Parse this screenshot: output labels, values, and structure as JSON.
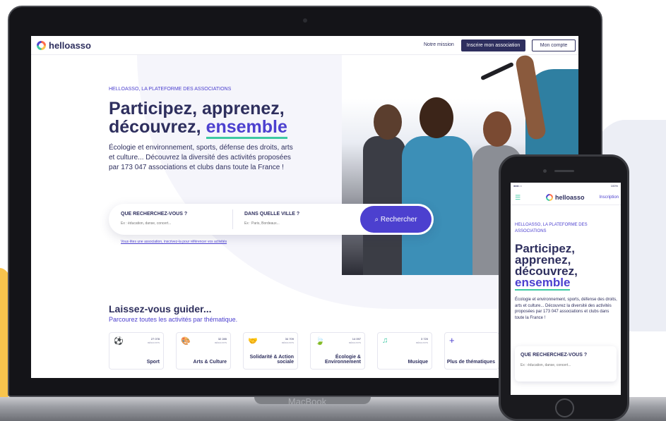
{
  "colors": {
    "brand_navy": "#2e2f5e",
    "brand_purple": "#4c40cf",
    "accent_green": "#3dc9a3",
    "accent_yellow": "#f8c44d"
  },
  "laptop": {
    "brand_label": "MacBook",
    "nav": {
      "logo_text": "helloasso",
      "mission_link": "Notre mission",
      "register_button": "Inscrire mon association",
      "account_button": "Mon compte"
    },
    "hero": {
      "eyebrow": "HELLOASSO, LA PLATEFORME DES ASSOCIATIONS",
      "title_line1": "Participez, apprenez,",
      "title_line2_prefix": "découvrez,",
      "title_highlight": "ensemble",
      "description": "Écologie et environnement, sports, défense des droits, arts et culture... Découvrez la diversité des activités proposées par 173 047 associations et clubs dans toute la France !"
    },
    "search": {
      "what_label": "QUE RECHERCHEZ-VOUS ?",
      "what_placeholder": "Ex : éducation, danse, concert...",
      "where_label": "DANS QUELLE VILLE ?",
      "where_placeholder": "Ex : Paris, Bordeaux...",
      "button_label": "Rechercher",
      "association_link": "Vous êtes une association, inscrivez-la pour référencer vos activités"
    },
    "guide": {
      "title": "Laissez-vous guider...",
      "subtitle": "Parcourez toutes les activités par thématique.",
      "cards": [
        {
          "icon": "sport-icon",
          "glyph": "⚽",
          "count": "27 078",
          "unit": "RÉSULTATS",
          "label": "Sport"
        },
        {
          "icon": "palette-icon",
          "glyph": "🎨",
          "count": "32 285",
          "unit": "RÉSULTATS",
          "label": "Arts & Culture"
        },
        {
          "icon": "handshake-icon",
          "glyph": "🤝",
          "count": "34 709",
          "unit": "RÉSULTATS",
          "label": "Solidarité & Action sociale"
        },
        {
          "icon": "leaf-icon",
          "glyph": "🍃",
          "count": "14 097",
          "unit": "RÉSULTATS",
          "label": "Écologie & Environnement"
        },
        {
          "icon": "music-icon",
          "glyph": "♫",
          "count": "3 720",
          "unit": "RÉSULTATS",
          "label": "Musique"
        },
        {
          "icon": "plus-icon",
          "glyph": "+",
          "count": "",
          "unit": "",
          "label": "Plus de thématiques"
        }
      ]
    }
  },
  "phone": {
    "status_left": "●●●○○",
    "status_right": "100%",
    "nav": {
      "logo_text": "helloasso",
      "signup_link": "Inscription",
      "menu_glyph": "☰"
    },
    "hero": {
      "eyebrow": "HELLOASSO, LA PLATEFORME DES ASSOCIATIONS",
      "title_line1": "Participez,",
      "title_line2": "apprenez,",
      "title_line3": "découvrez,",
      "title_highlight": "ensemble",
      "description": "Écologie et environnement, sports, défense des droits, arts et culture... Découvrez la diversité des activités proposées par 173 047 associations et clubs dans toute la France !"
    },
    "search": {
      "what_label": "QUE RECHERCHEZ-VOUS ?",
      "what_placeholder": "Ex : éducation, danse, concert..."
    }
  }
}
